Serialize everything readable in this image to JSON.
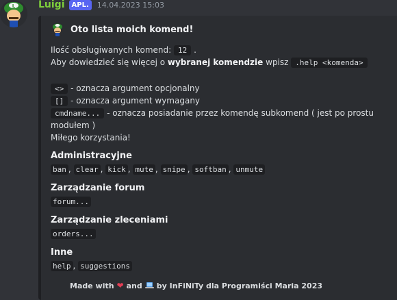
{
  "author": {
    "username": "Luigi",
    "badge": "APL.",
    "timestamp": "14.04.2023 15:03"
  },
  "embed": {
    "title": "Oto lista moich komend!",
    "count_label": "Ilość obsługiwanych komend:",
    "count_value": "12",
    "count_suffix": ".",
    "help_pre": "Aby dowiedzieć się więcej o",
    "help_bold": "wybranej komendzie",
    "help_post": "wpisz",
    "help_code": ".help <komenda>",
    "legend": [
      {
        "code": "<>",
        "text": "- oznacza argument opcjonalny"
      },
      {
        "code": "[]",
        "text": "- oznacza argument wymagany"
      },
      {
        "code": "cmdname...",
        "text": "- oznacza posiadanie przez komendę subkomend ( jest po prostu"
      }
    ],
    "legend_wrap": "modułem )",
    "closing": "Miłego korzystania!",
    "sections": [
      {
        "title": "Administracyjne",
        "commands": [
          "ban",
          "clear",
          "kick",
          "mute",
          "snipe",
          "softban",
          "unmute"
        ]
      },
      {
        "title": "Zarządzanie forum",
        "commands": [
          "forum..."
        ]
      },
      {
        "title": "Zarządzanie zleceniami",
        "commands": [
          "orders..."
        ]
      },
      {
        "title": "Inne",
        "commands": [
          "help",
          "suggestions"
        ]
      }
    ],
    "footer": {
      "made_with": "Made with",
      "and": "and",
      "credit": "by InFiNiTy dla Programiści Maria 2023"
    }
  },
  "colors": {
    "background": "#313338",
    "embed_bg": "#2b2d31",
    "username": "#7ecf3c",
    "badge": "#5865f2"
  }
}
